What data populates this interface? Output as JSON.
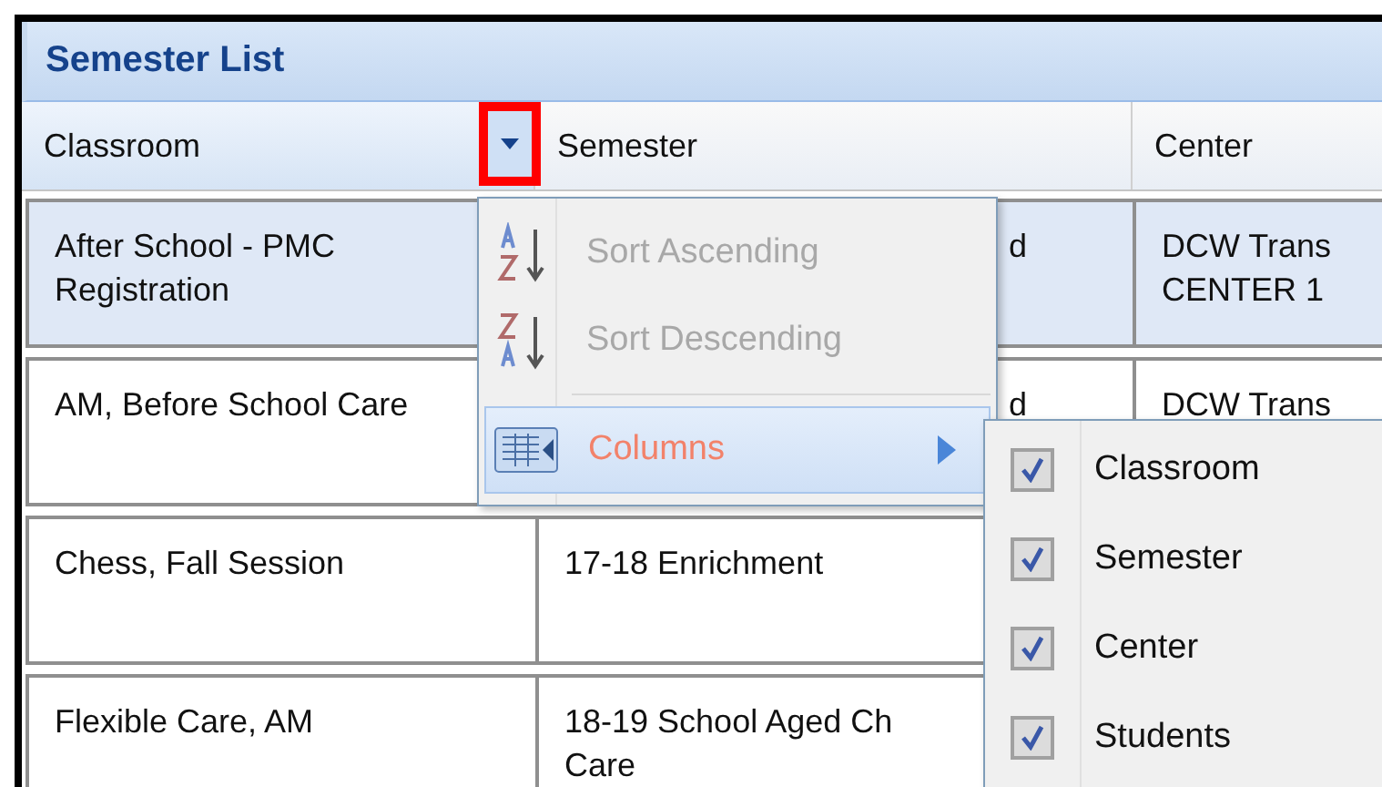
{
  "panel": {
    "title": "Semester List"
  },
  "columns": [
    {
      "label": "Classroom",
      "menu_open": true
    },
    {
      "label": "Semester",
      "menu_open": false
    },
    {
      "label": "Center",
      "menu_open": false
    }
  ],
  "rows": [
    {
      "selected": true,
      "classroom": "After School - PMC\nRegistration",
      "semester": "d",
      "center": "DCW Trans\nCENTER 1"
    },
    {
      "selected": false,
      "classroom": "AM, Before School Care",
      "semester": "d",
      "center": "DCW Trans"
    },
    {
      "selected": false,
      "classroom": "Chess, Fall Session",
      "semester": "17-18 Enrichment"
    },
    {
      "selected": false,
      "classroom": "Flexible Care, AM",
      "semester": "18-19 School Aged Ch\nCare"
    }
  ],
  "menu": {
    "items": [
      {
        "kind": "sort_asc",
        "label": "Sort Ascending",
        "disabled": true,
        "selected": false
      },
      {
        "kind": "sort_desc",
        "label": "Sort Descending",
        "disabled": true,
        "selected": false
      },
      {
        "kind": "separator"
      },
      {
        "kind": "submenu",
        "label": "Columns",
        "disabled": false,
        "selected": true
      }
    ]
  },
  "submenu": {
    "items": [
      {
        "label": "Classroom",
        "checked": true
      },
      {
        "label": "Semester",
        "checked": true
      },
      {
        "label": "Center",
        "checked": true
      },
      {
        "label": "Students",
        "checked": true
      }
    ]
  }
}
